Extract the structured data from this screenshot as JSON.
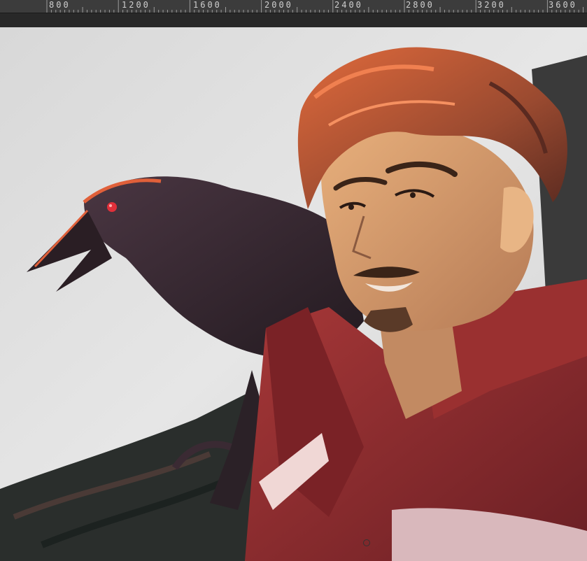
{
  "ruler": {
    "labels": [
      "800",
      "1200",
      "1600",
      "2000",
      "2400",
      "2800",
      "3200",
      "3600"
    ]
  },
  "colors": {
    "ruler_bg": "#3c3c3c",
    "toolbar_bg": "#282828",
    "canvas_bg": "#e4e4e4",
    "hair": "#b8543a",
    "skin": "#d69a6c",
    "coat": "#8f2b2b",
    "raven": "#3a2a33",
    "eye_red": "#e0303a"
  },
  "canvas": {
    "subject": "painting-artwork",
    "cursor_icon": "brush-cursor-icon"
  }
}
